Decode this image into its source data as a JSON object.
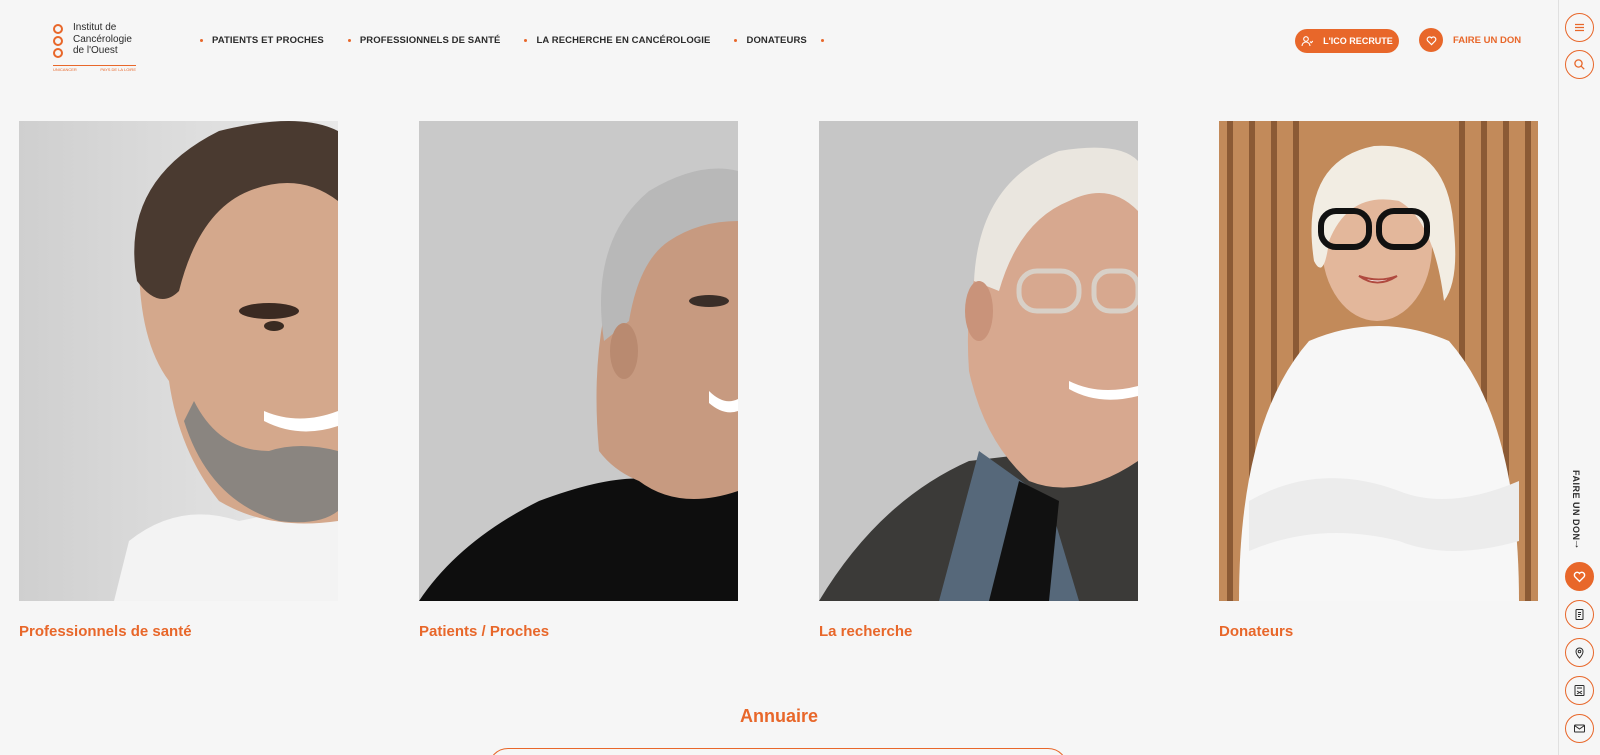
{
  "logo": {
    "line1": "Institut de",
    "line2": "Cancérologie",
    "line3": "de l'Ouest",
    "sub_left": "UNICANCER",
    "sub_right": "PAYS DE LA LOIRE"
  },
  "nav": {
    "items": [
      {
        "label": "PATIENTS ET PROCHES"
      },
      {
        "label": "PROFESSIONNELS DE SANTÉ"
      },
      {
        "label": "LA RECHERCHE EN CANCÉROLOGIE"
      },
      {
        "label": "DONATEURS"
      }
    ]
  },
  "header": {
    "recrute_label": "L'ICO RECRUTE",
    "don_label": "FAIRE UN DON"
  },
  "sidebar": {
    "vertical_label": "FAIRE UN DON",
    "arrow": "→"
  },
  "cards": [
    {
      "title": "Professionnels de santé"
    },
    {
      "title": "Patients / Proches"
    },
    {
      "title": "La recherche"
    },
    {
      "title": "Donateurs"
    }
  ],
  "annuaire": {
    "title": "Annuaire"
  },
  "colors": {
    "accent": "#e8672a",
    "background": "#f6f6f6"
  }
}
